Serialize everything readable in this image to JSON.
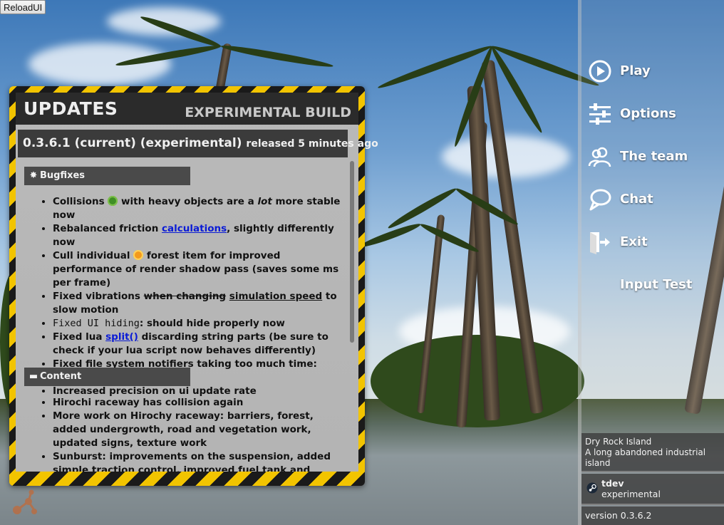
{
  "reload_button": {
    "label": "ReloadUI"
  },
  "updates": {
    "title": "UPDATES",
    "subtitle": "EXPERIMENTAL BUILD",
    "version_heading": "0.3.6.1 (current) (experimental)",
    "released": "released 5 minutes ago",
    "sections": [
      {
        "name": "Bugfixes",
        "icon": "burst-icon",
        "items": [
          {
            "parts": [
              "Collisions ",
              " with heavy objects are a ",
              "lot",
              " more stable now"
            ]
          },
          {
            "parts": [
              "Rebalanced friction ",
              "calculations",
              ", slightly differently now"
            ]
          },
          {
            "parts": [
              "Cull individual ",
              " forest item for improved performance of render shadow pass (saves some ms per frame)"
            ]
          },
          {
            "parts": [
              "Fixed vibrations ",
              "when changing",
              " ",
              "simulation speed",
              " to slow motion"
            ]
          },
          {
            "parts": [
              "Fixed UI hiding",
              ": should hide properly now"
            ]
          },
          {
            "parts": [
              "Fixed lua ",
              "split()",
              " discarding string parts (be sure to check if your lua script now behaves differently)"
            ]
          },
          {
            "parts": [
              "Fixed file system notifiers taking too much time: faster startup"
            ]
          },
          {
            "parts": [
              "Increased precision on ui update rate"
            ]
          }
        ]
      },
      {
        "name": "Content",
        "icon": "car-icon",
        "items": [
          {
            "parts": [
              "Hirochi raceway has collision again"
            ]
          },
          {
            "parts": [
              "More work on Hirochy raceway: barriers, forest, added undergrowth, road and vegetation work, updated signs, texture work"
            ]
          },
          {
            "parts": [
              "Sunburst: improvements on the suspension, added simple traction control, improved fuel tank and windshield"
            ]
          }
        ]
      }
    ]
  },
  "menu": {
    "items": [
      {
        "label": "Play",
        "icon": "play-icon"
      },
      {
        "label": "Options",
        "icon": "sliders-icon"
      },
      {
        "label": "The team",
        "icon": "team-icon"
      },
      {
        "label": "Chat",
        "icon": "chat-icon"
      },
      {
        "label": "Exit",
        "icon": "exit-icon"
      },
      {
        "label": "Input Test",
        "icon": ""
      }
    ]
  },
  "level": {
    "name": "Dry Rock Island",
    "description": "A long abandoned industrial island"
  },
  "user": {
    "name": "tdev",
    "branch": "experimental"
  },
  "version": "version 0.3.6.2",
  "colors": {
    "hazard_yellow": "#f2c400",
    "hazard_black": "#1a1a1a",
    "link": "#0a1bd6"
  }
}
